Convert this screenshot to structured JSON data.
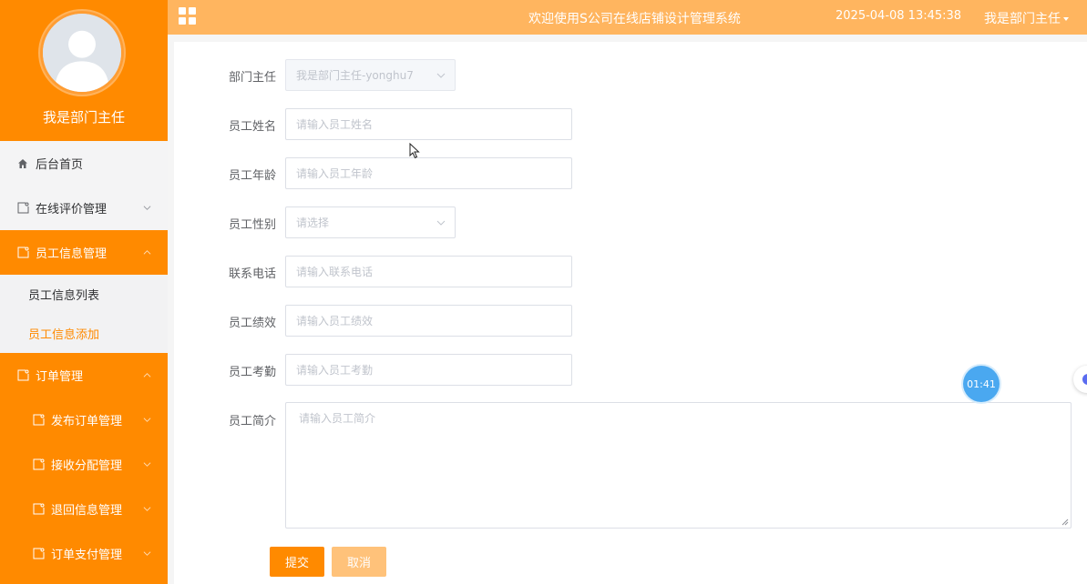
{
  "sidebar": {
    "profile_name": "我是部门主任",
    "items": [
      {
        "label": "后台首页"
      },
      {
        "label": "在线评价管理"
      },
      {
        "label": "员工信息管理"
      },
      {
        "label": "员工信息列表"
      },
      {
        "label": "员工信息添加"
      },
      {
        "label": "订单管理"
      },
      {
        "label": "发布订单管理"
      },
      {
        "label": "接收分配管理"
      },
      {
        "label": "退回信息管理"
      },
      {
        "label": "订单支付管理"
      }
    ]
  },
  "header": {
    "title": "欢迎使用S公司在线店铺设计管理系统",
    "datetime": "2025-04-08 13:45:38",
    "user": "我是部门主任"
  },
  "form": {
    "fields": [
      {
        "label": "部门主任",
        "value": "我是部门主任-yonghu7"
      },
      {
        "label": "员工姓名",
        "placeholder": "请输入员工姓名"
      },
      {
        "label": "员工年龄",
        "placeholder": "请输入员工年龄"
      },
      {
        "label": "员工性别",
        "placeholder": "请选择"
      },
      {
        "label": "联系电话",
        "placeholder": "请输入联系电话"
      },
      {
        "label": "员工绩效",
        "placeholder": "请输入员工绩效"
      },
      {
        "label": "员工考勤",
        "placeholder": "请输入员工考勤"
      },
      {
        "label": "员工简介",
        "placeholder": "请输入员工简介"
      }
    ],
    "submit_label": "提交",
    "cancel_label": "取消"
  },
  "timer": "01:41",
  "colors": {
    "accent": "#ff8a00",
    "header": "#ffb55f",
    "timer": "#4aa8f0"
  }
}
